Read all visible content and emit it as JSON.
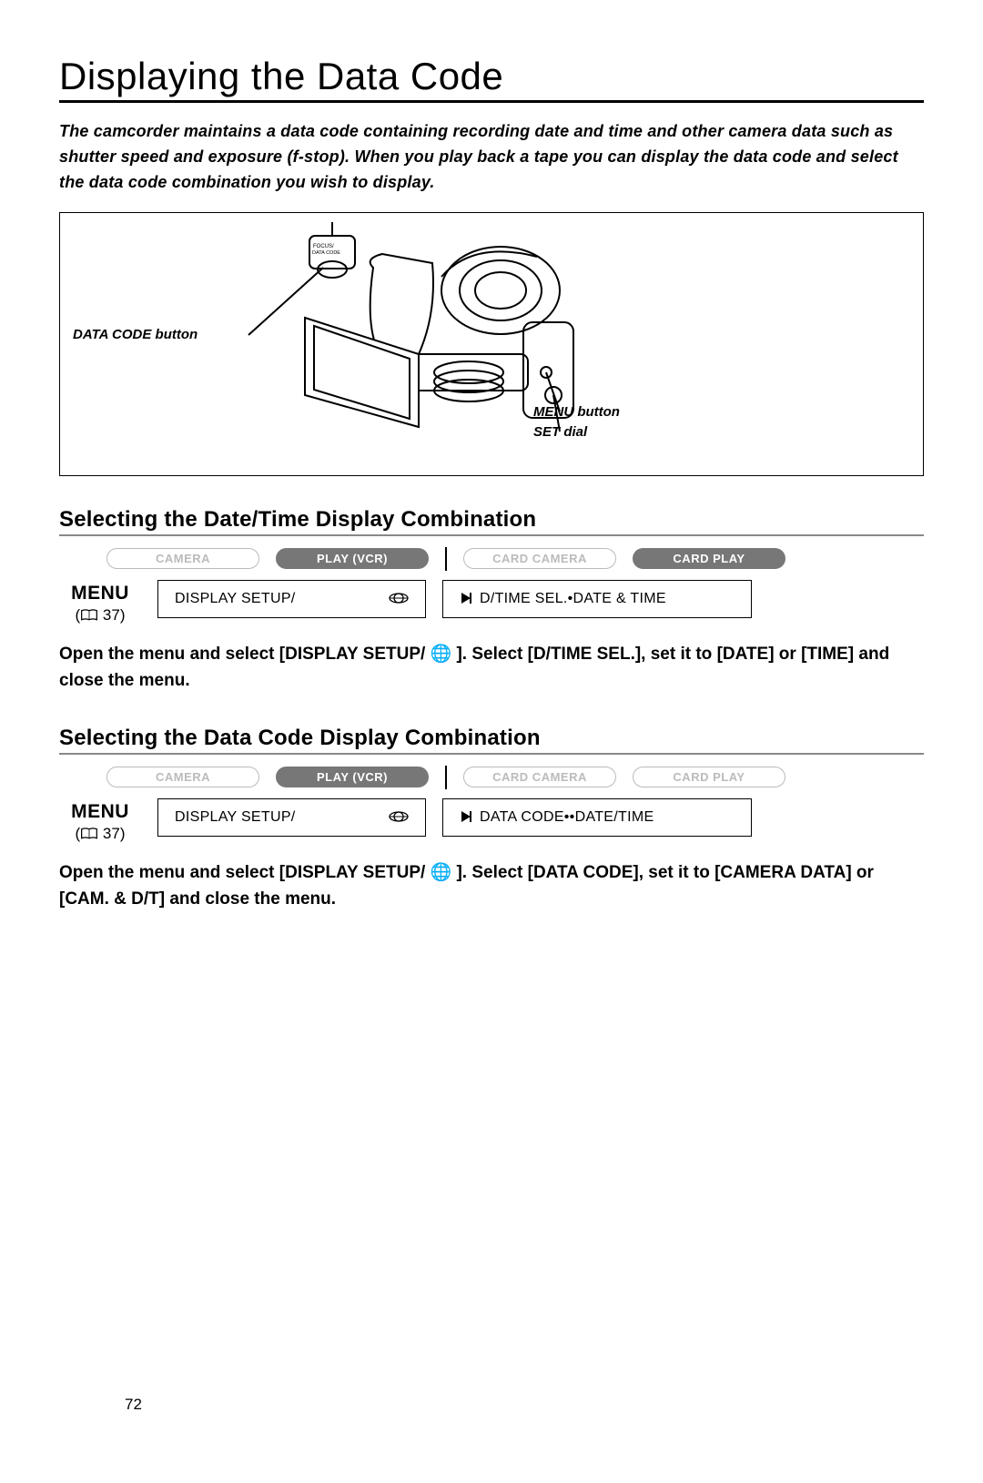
{
  "title": "Displaying the Data Code",
  "intro": "The camcorder maintains a data code containing recording date and time and other camera data such as shutter speed and exposure (f-stop). When you play back a tape you can display the data code and select the data code combination you wish to display.",
  "diagram": {
    "left_label": "DATA CODE button",
    "right_label_1": "MENU button",
    "right_label_2": "SET dial",
    "button_text": "FOCUS/\nDATA CODE"
  },
  "section1": {
    "heading": "Selecting the Date/Time Display Combination",
    "modes": {
      "camera": "CAMERA",
      "play": "PLAY (VCR)",
      "card_camera": "CARD CAMERA",
      "card_play": "CARD PLAY"
    },
    "menu_word": "MENU",
    "menu_ref": "37",
    "cell_a": "DISPLAY SETUP/",
    "cell_b": "D/TIME SEL.•DATE & TIME",
    "instruction": "Open the menu and select [DISPLAY SETUP/ 🌐 ]. Select [D/TIME SEL.], set it to [DATE] or [TIME] and close the menu."
  },
  "section2": {
    "heading": "Selecting the Data Code Display Combination",
    "modes": {
      "camera": "CAMERA",
      "play": "PLAY (VCR)",
      "card_camera": "CARD CAMERA",
      "card_play": "CARD PLAY"
    },
    "menu_word": "MENU",
    "menu_ref": "37",
    "cell_a": "DISPLAY SETUP/",
    "cell_b": "DATA CODE••DATE/TIME",
    "instruction": "Open the menu and select [DISPLAY SETUP/ 🌐 ]. Select [DATA CODE], set it to [CAMERA DATA] or [CAM. & D/T] and close the menu."
  },
  "page_number": "72"
}
